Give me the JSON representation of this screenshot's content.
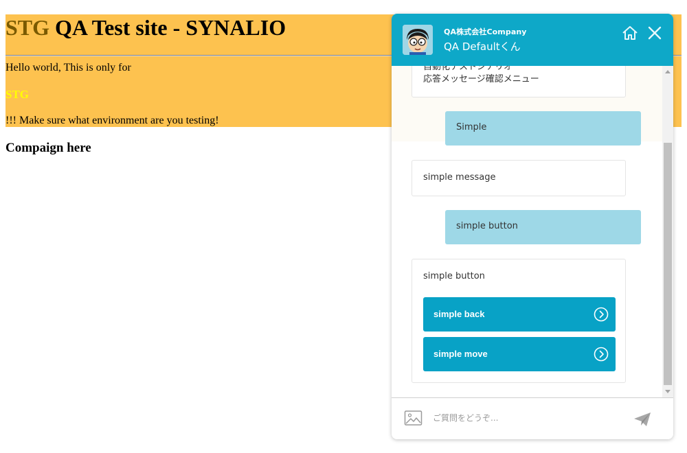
{
  "page": {
    "title_env": "STG",
    "title_rest": " QA Test site - SYNALIO",
    "hello": "Hello world, This is only for",
    "stg_label": "STG",
    "warning": "!!! Make sure what environment are you testing!",
    "campaign": "Compaign here",
    "banner_color": "#fdc24f"
  },
  "chat": {
    "header": {
      "company": "QA株式会社Company",
      "agent_name": "QA Defaultくん",
      "home_icon": "home-icon",
      "close_icon": "close-icon",
      "color": "#0ea8c8"
    },
    "messages": {
      "menu_line1": "自動化テストシナリオ",
      "menu_line2": "応答メッセージ確認メニュー",
      "user1": "Simple",
      "bot1": "simple message",
      "user2": "simple button",
      "bot2": "simple button",
      "buttons": [
        {
          "label": "simple back"
        },
        {
          "label": "simple move"
        }
      ]
    },
    "footer": {
      "placeholder": "ご質問をどうぞ...",
      "image_icon": "image-upload-icon",
      "send_icon": "send-icon"
    }
  }
}
